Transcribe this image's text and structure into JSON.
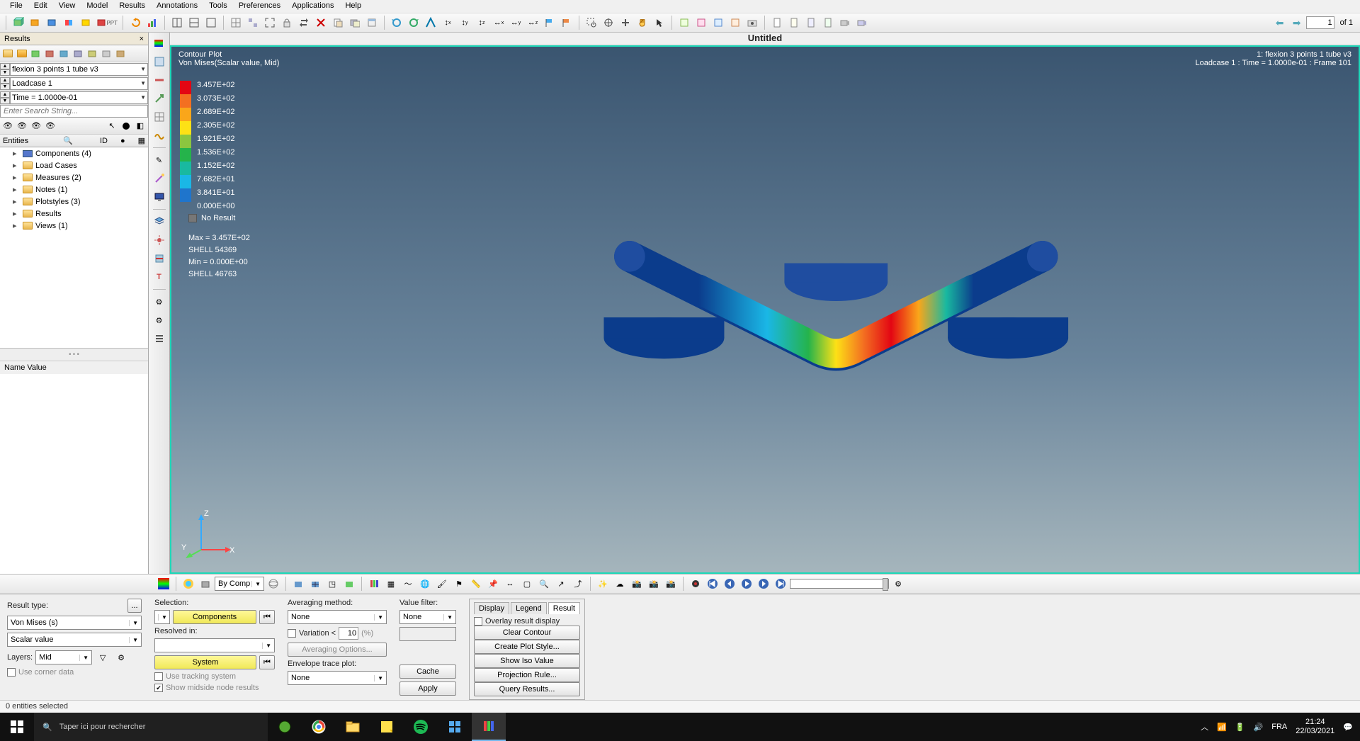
{
  "menubar": [
    "File",
    "Edit",
    "View",
    "Model",
    "Results",
    "Annotations",
    "Tools",
    "Preferences",
    "Applications",
    "Help"
  ],
  "page_indicator": {
    "value": "1",
    "of_label": "of 1"
  },
  "results_tab": {
    "title": "Results",
    "close": "×"
  },
  "model_select": "flexion 3 points 1 tube v3",
  "loadcase_select": "Loadcase 1",
  "time_select": "Time = 1.0000e-01",
  "search_placeholder": "Enter Search String...",
  "entities_hdr": {
    "left": "Entities",
    "id": "ID"
  },
  "tree": [
    {
      "icon": "comp",
      "label": "Components (4)"
    },
    {
      "icon": "folder",
      "label": "Load Cases"
    },
    {
      "icon": "folder",
      "label": "Measures (2)"
    },
    {
      "icon": "folder",
      "label": "Notes (1)"
    },
    {
      "icon": "folder",
      "label": "Plotstyles (3)"
    },
    {
      "icon": "folder",
      "label": "Results"
    },
    {
      "icon": "folder",
      "label": "Views (1)"
    }
  ],
  "name_value": "Name Value",
  "viewport_title": "Untitled",
  "contour": {
    "title": "Contour Plot",
    "subtitle": "Von Mises(Scalar value, Mid)",
    "top_right_1": "1: flexion 3 points 1 tube v3",
    "top_right_2": "Loadcase 1 : Time = 1.0000e-01 : Frame 101",
    "legend_values": [
      "3.457E+02",
      "3.073E+02",
      "2.689E+02",
      "2.305E+02",
      "1.921E+02",
      "1.536E+02",
      "1.152E+02",
      "7.682E+01",
      "3.841E+01",
      "0.000E+00"
    ],
    "legend_colors": [
      "#e30613",
      "#f36f21",
      "#faa61a",
      "#fde116",
      "#8bc63f",
      "#25b34b",
      "#19b9a0",
      "#1ab7e6",
      "#1f75cc",
      "#0b3c8c"
    ],
    "no_result": "No Result",
    "max_l1": "Max =  3.457E+02",
    "max_l2": "SHELL 54369",
    "min_l1": "Min =  0.000E+00",
    "min_l2": "SHELL 46763",
    "triad": {
      "x": "X",
      "y": "Y",
      "z": "Z"
    }
  },
  "btoolbar": {
    "bycomp": "By Comp"
  },
  "bottom": {
    "result_type_label": "Result type:",
    "result_type": "Von Mises (s)",
    "scalar": "Scalar value",
    "layers_label": "Layers:",
    "layers": "Mid",
    "use_corner": "Use corner data",
    "selection_label": "Selection:",
    "components_btn": "Components",
    "resolved_label": "Resolved in:",
    "system_btn": "System",
    "use_tracking": "Use tracking system",
    "show_midside": "Show midside node results",
    "avg_method_label": "Averaging method:",
    "avg_method": "None",
    "variation_label": "Variation <",
    "variation_val": "10",
    "variation_pct": "(%)",
    "avg_options": "Averaging Options...",
    "env_label": "Envelope trace plot:",
    "env": "None",
    "value_filter_label": "Value filter:",
    "value_filter": "None",
    "cache": "Cache",
    "apply": "Apply",
    "tabs": {
      "display": "Display",
      "legend": "Legend",
      "result": "Result"
    },
    "overlay": "Overlay result display",
    "clear_contour": "Clear Contour",
    "create_plot": "Create Plot Style...",
    "show_iso": "Show Iso Value",
    "proj_rule": "Projection Rule...",
    "query_results": "Query Results..."
  },
  "status": "0 entities selected",
  "taskbar": {
    "search_placeholder": "Taper ici pour rechercher",
    "lang": "FRA",
    "time": "21:24",
    "date": "22/03/2021"
  }
}
